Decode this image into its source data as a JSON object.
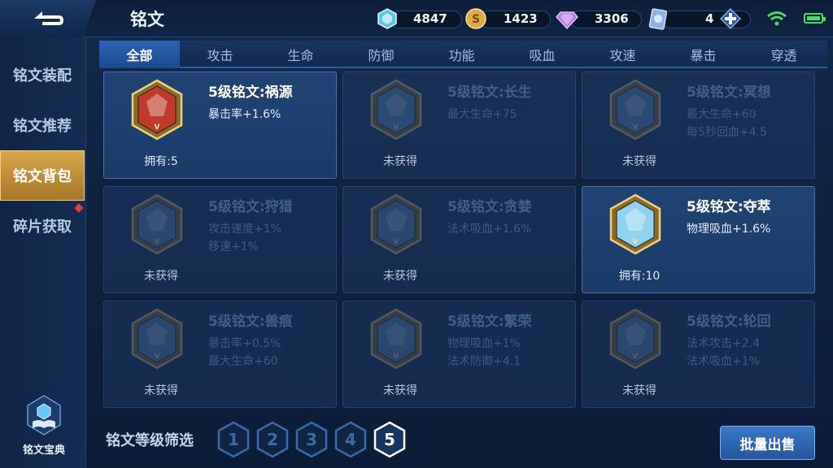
{
  "header": {
    "title": "铭文",
    "resources": [
      {
        "icon": "diamond-crystal-icon",
        "value": "4847"
      },
      {
        "icon": "gold-coin-icon",
        "value": "1423"
      },
      {
        "icon": "purple-gem-icon",
        "value": "3306"
      },
      {
        "icon": "rune-ticket-icon",
        "value": "4"
      }
    ]
  },
  "sidebar": {
    "items": [
      {
        "label": "铭文装配"
      },
      {
        "label": "铭文推荐"
      },
      {
        "label": "铭文背包"
      },
      {
        "label": "碎片获取"
      }
    ],
    "codex_label": "铭文宝典"
  },
  "tabs": [
    "全部",
    "攻击",
    "生命",
    "防御",
    "功能",
    "吸血",
    "攻速",
    "暴击",
    "穿透"
  ],
  "cards": [
    {
      "name": "5级铭文:祸源",
      "attrs": [
        "暴击率+1.6%"
      ],
      "status": "拥有:5",
      "owned": true,
      "color": "#c0392b"
    },
    {
      "name": "5级铭文:长生",
      "attrs": [
        "最大生命+75"
      ],
      "status": "未获得",
      "owned": false,
      "color": "#5b8fc8"
    },
    {
      "name": "5级铭文:冥想",
      "attrs": [
        "最大生命+60",
        "每5秒回血+4.5"
      ],
      "status": "未获得",
      "owned": false,
      "color": "#5b8fc8"
    },
    {
      "name": "5级铭文:狩猎",
      "attrs": [
        "攻击速度+1%",
        "移速+1%"
      ],
      "status": "未获得",
      "owned": false,
      "color": "#5b8fc8"
    },
    {
      "name": "5级铭文:贪婪",
      "attrs": [
        "法术吸血+1.6%"
      ],
      "status": "未获得",
      "owned": false,
      "color": "#5b8fc8"
    },
    {
      "name": "5级铭文:夺萃",
      "attrs": [
        "物理吸血+1.6%"
      ],
      "status": "拥有:10",
      "owned": true,
      "color": "#8fd3f0"
    },
    {
      "name": "5级铭文:兽痕",
      "attrs": [
        "暴击率+0.5%",
        "最大生命+60"
      ],
      "status": "未获得",
      "owned": false,
      "color": "#5b8fc8"
    },
    {
      "name": "5级铭文:繁荣",
      "attrs": [
        "物理吸血+1%",
        "法术防御+4.1"
      ],
      "status": "未获得",
      "owned": false,
      "color": "#5b8fc8"
    },
    {
      "name": "5级铭文:轮回",
      "attrs": [
        "法术攻击+2.4",
        "法术吸血+1%"
      ],
      "status": "未获得",
      "owned": false,
      "color": "#5b8fc8"
    }
  ],
  "filter": {
    "label": "铭文等级筛选",
    "levels": [
      "1",
      "2",
      "3",
      "4",
      "5"
    ],
    "selected": "5"
  },
  "sell_button": "批量出售"
}
